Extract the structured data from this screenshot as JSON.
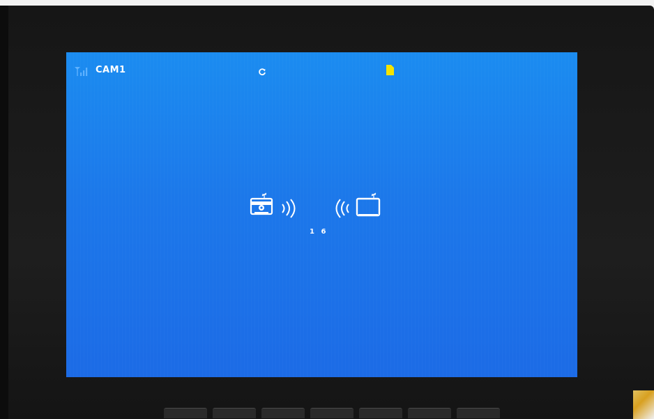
{
  "status_bar": {
    "signal_icon": "signal-strength-icon",
    "camera_label": "CAM1",
    "sync_icon": "sync-icon",
    "sd_card_icon": "sd-card-icon",
    "sd_card_color": "#f5e400"
  },
  "pairing": {
    "camera_icon": "camera-transmitter-icon",
    "waves_out_icon": "wireless-waves-out-icon",
    "waves_in_icon": "wireless-waves-in-icon",
    "monitor_icon": "monitor-receiver-icon",
    "countdown": "1 6"
  },
  "colors": {
    "screen_top": "#1b8cf0",
    "screen_bottom": "#1c6be6",
    "icon": "#ffffff"
  }
}
